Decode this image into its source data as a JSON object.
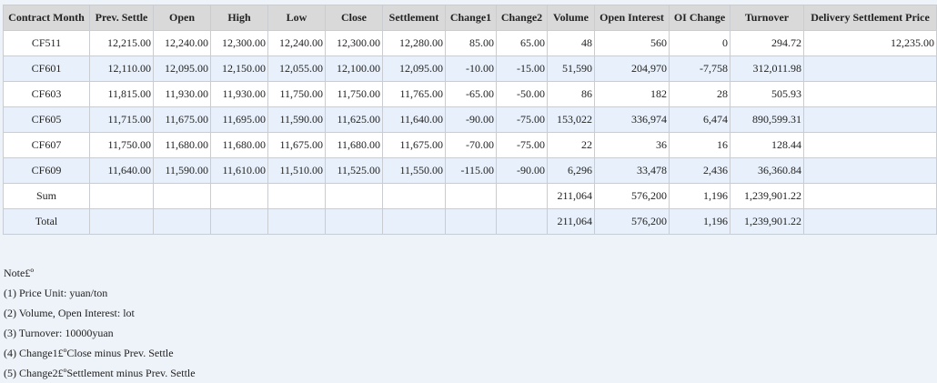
{
  "table": {
    "headers": [
      "Contract Month",
      "Prev. Settle",
      "Open",
      "High",
      "Low",
      "Close",
      "Settlement",
      "Change1",
      "Change2",
      "Volume",
      "Open Interest",
      "OI Change",
      "Turnover",
      "Delivery Settlement Price"
    ],
    "rows": [
      [
        "CF511",
        "12,215.00",
        "12,240.00",
        "12,300.00",
        "12,240.00",
        "12,300.00",
        "12,280.00",
        "85.00",
        "65.00",
        "48",
        "560",
        "0",
        "294.72",
        "12,235.00"
      ],
      [
        "CF601",
        "12,110.00",
        "12,095.00",
        "12,150.00",
        "12,055.00",
        "12,100.00",
        "12,095.00",
        "-10.00",
        "-15.00",
        "51,590",
        "204,970",
        "-7,758",
        "312,011.98",
        ""
      ],
      [
        "CF603",
        "11,815.00",
        "11,930.00",
        "11,930.00",
        "11,750.00",
        "11,750.00",
        "11,765.00",
        "-65.00",
        "-50.00",
        "86",
        "182",
        "28",
        "505.93",
        ""
      ],
      [
        "CF605",
        "11,715.00",
        "11,675.00",
        "11,695.00",
        "11,590.00",
        "11,625.00",
        "11,640.00",
        "-90.00",
        "-75.00",
        "153,022",
        "336,974",
        "6,474",
        "890,599.31",
        ""
      ],
      [
        "CF607",
        "11,750.00",
        "11,680.00",
        "11,680.00",
        "11,675.00",
        "11,680.00",
        "11,675.00",
        "-70.00",
        "-75.00",
        "22",
        "36",
        "16",
        "128.44",
        ""
      ],
      [
        "CF609",
        "11,640.00",
        "11,590.00",
        "11,610.00",
        "11,510.00",
        "11,525.00",
        "11,550.00",
        "-115.00",
        "-90.00",
        "6,296",
        "33,478",
        "2,436",
        "36,360.84",
        ""
      ],
      [
        "Sum",
        "",
        "",
        "",
        "",
        "",
        "",
        "",
        "",
        "211,064",
        "576,200",
        "1,196",
        "1,239,901.22",
        ""
      ],
      [
        "Total",
        "",
        "",
        "",
        "",
        "",
        "",
        "",
        "",
        "211,064",
        "576,200",
        "1,196",
        "1,239,901.22",
        ""
      ]
    ]
  },
  "notes": {
    "title": "Note£º",
    "items": [
      "(1) Price Unit: yuan/ton",
      "(2) Volume, Open Interest: lot",
      "(3) Turnover: 10000yuan",
      "(4) Change1£ºClose minus Prev. Settle",
      "(5) Change2£ºSettlement minus Prev. Settle"
    ]
  }
}
